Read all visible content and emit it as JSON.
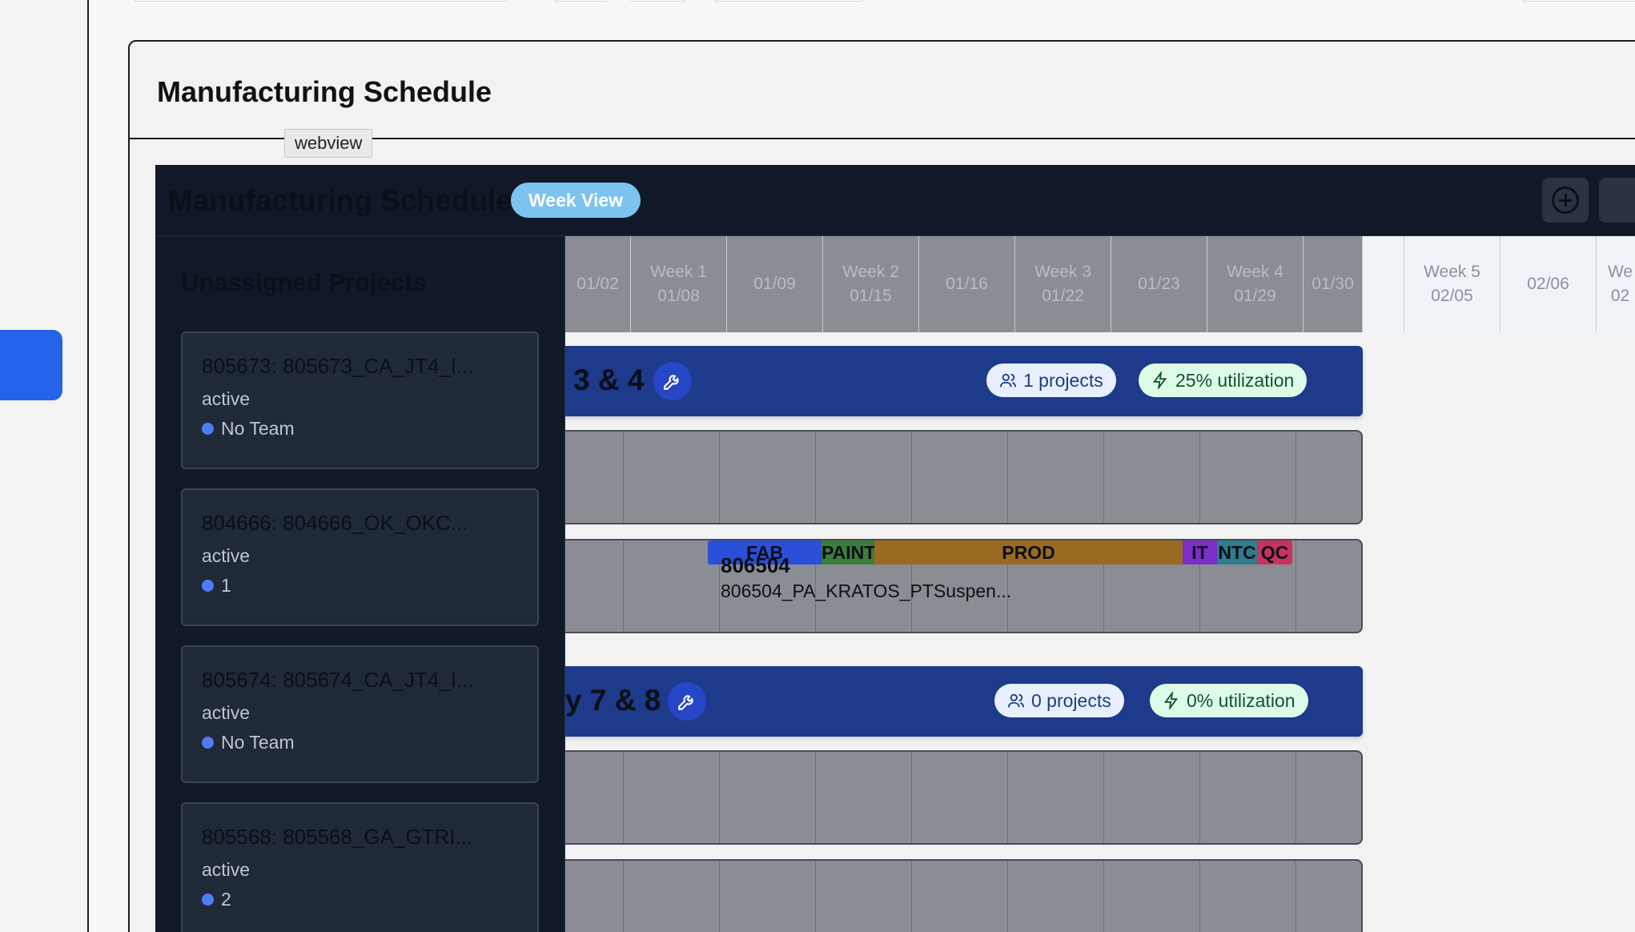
{
  "card": {
    "title": "Manufacturing Schedule",
    "tag": "webview"
  },
  "webview": {
    "title": "Manufacturing Schedule",
    "view_pill": "Week View",
    "add_icon": "plus-circle-icon"
  },
  "unassigned": {
    "title": "Unassigned Projects",
    "projects": [
      {
        "name": "805673: 805673_CA_JT4_I...",
        "status": "active",
        "team": "No Team"
      },
      {
        "name": "804666: 804666_OK_OKC...",
        "status": "active",
        "team": "1"
      },
      {
        "name": "805674: 805674_CA_JT4_I...",
        "status": "active",
        "team": "No Team"
      },
      {
        "name": "805568: 805568_GA_GTRI...",
        "status": "active",
        "team": "2"
      }
    ]
  },
  "timeline": {
    "columns": [
      {
        "line1": "01/02",
        "line2": ""
      },
      {
        "line1": "Week 1",
        "line2": "01/08"
      },
      {
        "line1": "01/09",
        "line2": ""
      },
      {
        "line1": "Week 2",
        "line2": "01/15"
      },
      {
        "line1": "01/16",
        "line2": ""
      },
      {
        "line1": "Week 3",
        "line2": "01/22"
      },
      {
        "line1": "01/23",
        "line2": ""
      },
      {
        "line1": "Week 4",
        "line2": "01/29"
      },
      {
        "line1": "01/30",
        "line2": ""
      },
      {
        "line1": "Week 5",
        "line2": "02/05"
      },
      {
        "line1": "02/06",
        "line2": ""
      },
      {
        "line1": "We",
        "line2": "02"
      }
    ],
    "teams": [
      {
        "name": "3 & 4",
        "projects_chip": "1 projects",
        "utilization_chip": "25% utilization"
      },
      {
        "name": "y 7 & 8",
        "projects_chip": "0 projects",
        "utilization_chip": "0% utilization"
      }
    ],
    "job": {
      "id": "806504",
      "name": "806504_PA_KRATOS_PTSuspen...",
      "phases": [
        {
          "label": "FAB",
          "color": "#2a4fd8"
        },
        {
          "label": "PAINT",
          "color": "#3b7d3a"
        },
        {
          "label": "PROD",
          "color": "#9a6a22"
        },
        {
          "label": "IT",
          "color": "#7c2fc7"
        },
        {
          "label": "NTC",
          "color": "#2e7d8f"
        },
        {
          "label": "QC",
          "color": "#c8315e"
        }
      ]
    }
  }
}
